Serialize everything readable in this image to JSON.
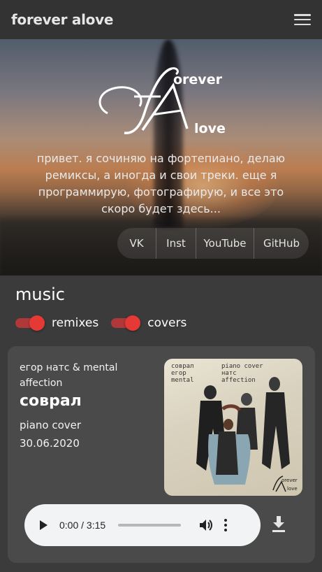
{
  "header": {
    "brand": "forever alove",
    "menu_icon": "hamburger-menu-icon"
  },
  "hero": {
    "logo": {
      "mark": "fA",
      "word_top": "orever",
      "word_bottom": "love"
    },
    "intro": "привет. я сочиняю на фортепиано, делаю ремиксы, а иногда и свои треки. еще я программирую, фотографирую, и все это скоро будет здесь...",
    "links": [
      "VK",
      "Inst",
      "YouTube",
      "GitHub"
    ]
  },
  "music": {
    "title": "music",
    "filters": [
      {
        "label": "remixes",
        "on": true
      },
      {
        "label": "covers",
        "on": true
      }
    ],
    "accent": "#e53935"
  },
  "track": {
    "artist": "егор натс & mental affection",
    "title": "соврал",
    "type": "piano cover",
    "date": "30.06.2020",
    "cover_text": {
      "left_1": "соврал",
      "left_2": "егор",
      "left_3": "mental",
      "right_1": "piano cover",
      "right_2": "натс",
      "right_3": "affection",
      "logo_word_top": "orever",
      "logo_word_bottom": "love"
    },
    "player": {
      "time": "0:00 / 3:15",
      "progress": 0
    },
    "download_icon": "download-icon"
  }
}
